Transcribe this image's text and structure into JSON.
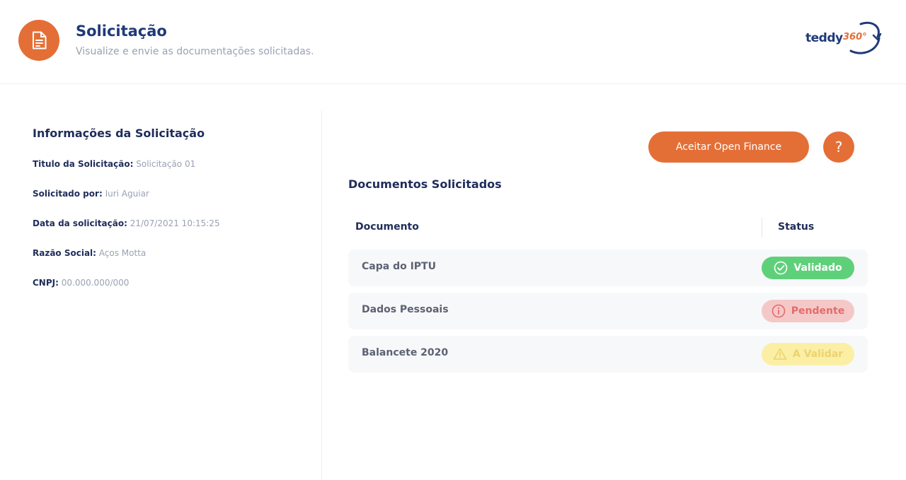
{
  "header": {
    "icon": "document-icon",
    "title": "Solicitação",
    "subtitle": "Visualize e envie as documentações solicitadas.",
    "logo_text": "teddy",
    "logo_number": "360°"
  },
  "info": {
    "title": "Informações da Solicitação",
    "fields": [
      {
        "label": "Titulo da Solicitação:",
        "value": "Solicitação 01"
      },
      {
        "label": "Solicitado por:",
        "value": "Iuri Aguiar"
      },
      {
        "label": "Data da solicitação:",
        "value": "21/07/2021 10:15:25"
      },
      {
        "label": "Razão Social:",
        "value": "Aços Motta"
      },
      {
        "label": "CNPJ:",
        "value": "00.000.000/000"
      }
    ]
  },
  "actions": {
    "accept_label": "Aceitar Open Finance",
    "help_label": "?"
  },
  "documents": {
    "title": "Documentos Solicitados",
    "columns": {
      "document": "Documento",
      "status": "Status"
    },
    "rows": [
      {
        "name": "Capa do IPTU",
        "status": "Validado",
        "status_icon": "check-circle-icon",
        "status_color": "#5fd07a"
      },
      {
        "name": "Dados Pessoais",
        "status": "Pendente",
        "status_icon": "info-circle-icon",
        "status_color": "#e46b6b"
      },
      {
        "name": "Balancete 2020",
        "status": "A Validar",
        "status_icon": "warning-triangle-icon",
        "status_color": "#ecd36f"
      }
    ]
  },
  "colors": {
    "accent": "#e46f36",
    "primary_text": "#1f2d5a",
    "muted_text": "#9aa1b4"
  }
}
